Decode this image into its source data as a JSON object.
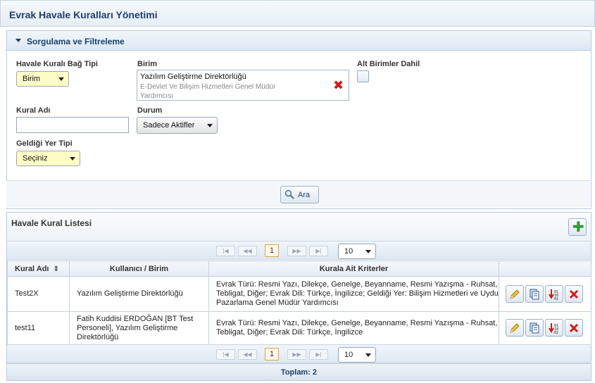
{
  "page": {
    "title": "Evrak Havale Kuralları Yönetimi"
  },
  "filter": {
    "header": "Sorgulama ve Filtreleme",
    "bag_tipi": {
      "label": "Havale Kuralı Bağ Tipi",
      "value": "Birim"
    },
    "birim": {
      "label": "Birim",
      "value": "Yazılım Geliştirme Direktörlüğü",
      "parent": "E-Devlet Ve Bilişim Hizmetleri Genel Müdür Yardımcısı"
    },
    "alt_birimler": {
      "label": "Alt Birimler Dahil",
      "checked": false
    },
    "kural_adi": {
      "label": "Kural Adı",
      "value": ""
    },
    "durum": {
      "label": "Durum",
      "value": "Sadece Aktifler"
    },
    "geldigi_yer": {
      "label": "Geldiği Yer Tipi",
      "value": "Seçiniz"
    },
    "search_button": "Ara"
  },
  "list": {
    "header": "Havale Kural Listesi",
    "pager": {
      "page": "1",
      "page_size": "10"
    },
    "columns": [
      "Kural Adı",
      "Kullanıcı / Birim",
      "Kurala Ait Kriterler",
      ""
    ],
    "rows": [
      {
        "name": "Test2X",
        "user": "Yazılım Geliştirme Direktörlüğü",
        "criteria": "Evrak Türü: Resmi Yazı, Dilekçe, Genelge, Beyanname, Resmi Yazışma - Ruhsat, Tebligat, Diğer; Evrak Dili: Türkçe, İngilizce; Geldiği Yer: Bilişim Hizmetleri ve Uydu Pazarlama Genel Müdür Yardımcısı"
      },
      {
        "name": "test11",
        "user": "Fatih Kuddisi ERDOĞAN [BT Test Personeli], Yazılım Geliştirme Direktörlüğü",
        "criteria": "Evrak Türü: Resmi Yazı, Dilekçe, Genelge, Beyanname, Resmi Yazışma - Ruhsat, Tebligat, Diğer; Evrak Dili: Türkçe, İngilizce"
      }
    ],
    "total": "Toplam: 2"
  },
  "icons": {
    "add": "plus-icon",
    "search": "magnifier-icon",
    "edit": "pencil-icon",
    "copy": "copy-icon",
    "order": "binary-sort-icon",
    "delete": "delete-x-icon",
    "first": "first-page-icon",
    "prev": "prev-page-icon",
    "next": "next-page-icon",
    "last": "last-page-icon"
  },
  "colors": {
    "title": "#1c3f6e",
    "highlight_field": "#fffdc7",
    "delete": "#d01a1a",
    "add": "#2a9d2a"
  }
}
